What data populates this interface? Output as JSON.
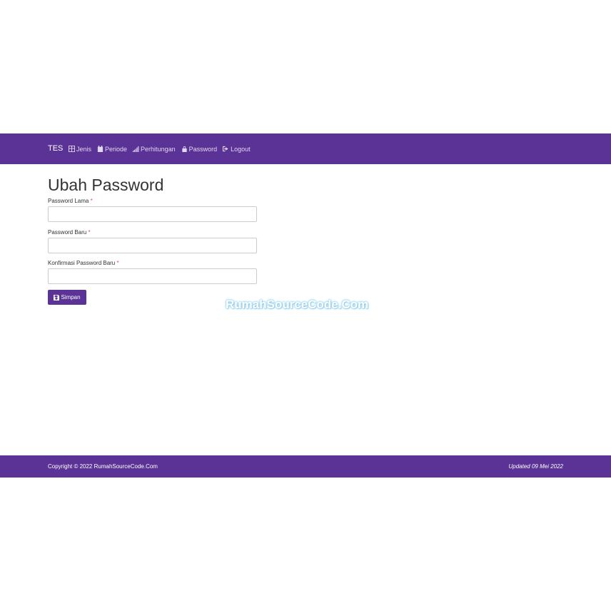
{
  "navbar": {
    "brand": "TES",
    "items": [
      {
        "label": "Jenis",
        "icon": "table-icon"
      },
      {
        "label": "Periode",
        "icon": "calendar-icon"
      },
      {
        "label": "Perhitungan",
        "icon": "signal-icon"
      },
      {
        "label": "Password",
        "icon": "lock-icon"
      },
      {
        "label": "Logout",
        "icon": "logout-icon"
      }
    ]
  },
  "page": {
    "title": "Ubah Password"
  },
  "form": {
    "old_password": {
      "label": "Password Lama",
      "required_mark": "*",
      "value": ""
    },
    "new_password": {
      "label": "Password Baru",
      "required_mark": "*",
      "value": ""
    },
    "confirm_password": {
      "label": "Konfirmasi Password Baru",
      "required_mark": "*",
      "value": ""
    },
    "submit_label": "Simpan"
  },
  "watermark": "RumahSourceCode.Com",
  "footer": {
    "copyright": "Copyright © 2022 RumahSourceCode.Com",
    "updated": "Updated 09 Mei 2022"
  },
  "colors": {
    "primary": "#5b3296",
    "required": "#d9534f"
  }
}
